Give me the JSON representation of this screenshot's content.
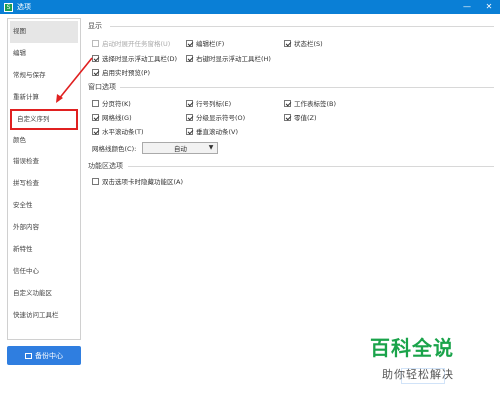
{
  "window": {
    "title": "选项",
    "app_icon": "wps-spreadsheet-icon",
    "minimize": "—",
    "close": "✕"
  },
  "sidebar": {
    "items": [
      {
        "label": "视图"
      },
      {
        "label": "编辑"
      },
      {
        "label": "常规与保存"
      },
      {
        "label": "重新计算"
      },
      {
        "label": "自定义序列"
      },
      {
        "label": "颜色"
      },
      {
        "label": "错误检查"
      },
      {
        "label": "拼写检查"
      },
      {
        "label": "安全性"
      },
      {
        "label": "外部内容"
      },
      {
        "label": "新特性"
      },
      {
        "label": "信任中心"
      },
      {
        "label": "自定义功能区"
      },
      {
        "label": "快速访问工具栏"
      }
    ],
    "backup_button": "备份中心"
  },
  "display": {
    "title": "显示",
    "options": [
      {
        "label": "启动时展开任务窗格(U)",
        "checked": false,
        "disabled": true
      },
      {
        "label": "编辑栏(F)",
        "checked": true
      },
      {
        "label": "状态栏(S)",
        "checked": true
      },
      {
        "label": "选择时显示浮动工具栏(D)",
        "checked": true
      },
      {
        "label": "右键时显示浮动工具栏(H)",
        "checked": true
      },
      {
        "label": "启用实时预览(P)",
        "checked": true
      }
    ]
  },
  "window_options": {
    "title": "窗口选项",
    "options": [
      {
        "label": "分页符(K)",
        "checked": false
      },
      {
        "label": "行号列标(E)",
        "checked": true
      },
      {
        "label": "工作表标签(B)",
        "checked": true
      },
      {
        "label": "网格线(G)",
        "checked": true
      },
      {
        "label": "分级显示符号(O)",
        "checked": true
      },
      {
        "label": "零值(Z)",
        "checked": true
      },
      {
        "label": "水平滚动条(T)",
        "checked": true
      },
      {
        "label": "垂直滚动条(V)",
        "checked": true
      }
    ],
    "gridline_color_label": "网格线颜色(C):",
    "gridline_color_value": "自动"
  },
  "ribbon": {
    "title": "功能区选项",
    "options": [
      {
        "label": "双击选项卡时隐藏功能区(A)",
        "checked": false
      }
    ]
  },
  "watermark": {
    "title": "百科全说",
    "subtitle": "助你轻松解决"
  },
  "colors": {
    "titlebar": "#0a7fd6",
    "accent": "#2f7ee0",
    "highlight": "#e02020",
    "watermark": "#1aa34a"
  }
}
